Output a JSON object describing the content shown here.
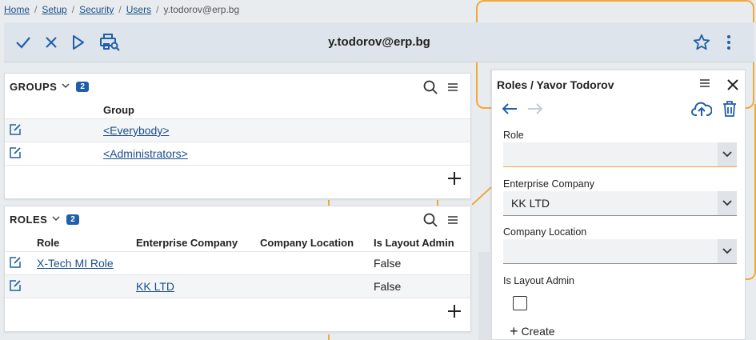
{
  "breadcrumb": {
    "items": [
      "Home",
      "Setup",
      "Security",
      "Users"
    ],
    "current": "y.todorov@erp.bg",
    "separator": "/"
  },
  "toolbar": {
    "title": "y.todorov@erp.bg",
    "icons": [
      "check-icon",
      "close-icon",
      "play-icon",
      "print-preview-icon",
      "star-icon",
      "more-vertical-icon"
    ]
  },
  "groups": {
    "title": "GROUPS",
    "count": "2",
    "columns": [
      "Group"
    ],
    "rows": [
      {
        "group": "<Everybody>"
      },
      {
        "group": "<Administrators>"
      }
    ]
  },
  "roles": {
    "title": "ROLES",
    "count": "2",
    "columns": [
      "Role",
      "Enterprise Company",
      "Company Location",
      "Is Layout Admin"
    ],
    "rows": [
      {
        "role": "X-Tech MI Role",
        "company": "",
        "location": "",
        "layout_admin": "False"
      },
      {
        "role": "",
        "company": "KK LTD",
        "location": "",
        "layout_admin": "False"
      }
    ]
  },
  "detail": {
    "title": "Roles / Yavor Todorov",
    "fields": {
      "role": {
        "label": "Role",
        "value": ""
      },
      "company": {
        "label": "Enterprise Company",
        "value": "KK LTD"
      },
      "location": {
        "label": "Company Location",
        "value": ""
      },
      "layout_admin": {
        "label": "Is Layout Admin",
        "checked": false
      }
    },
    "create_label": "Create"
  },
  "colors": {
    "accent": "#1f5fa8",
    "link": "#1a4f8a",
    "orange": "#f0a93a",
    "toolbar_bg": "#dde4eb"
  }
}
